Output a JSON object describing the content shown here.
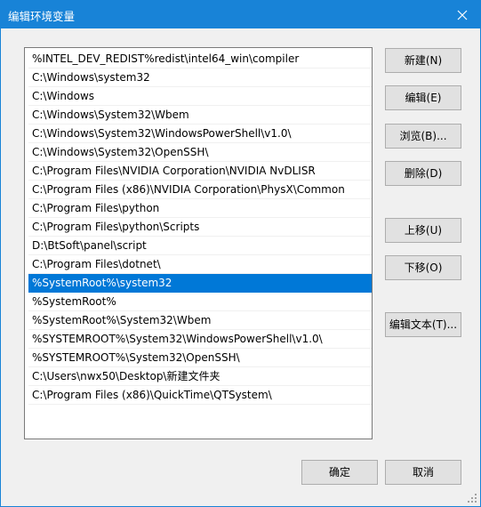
{
  "window": {
    "title": "编辑环境变量"
  },
  "paths": [
    "%INTEL_DEV_REDIST%redist\\intel64_win\\compiler",
    "C:\\Windows\\system32",
    "C:\\Windows",
    "C:\\Windows\\System32\\Wbem",
    "C:\\Windows\\System32\\WindowsPowerShell\\v1.0\\",
    "C:\\Windows\\System32\\OpenSSH\\",
    "C:\\Program Files\\NVIDIA Corporation\\NVIDIA NvDLISR",
    "C:\\Program Files (x86)\\NVIDIA Corporation\\PhysX\\Common",
    "C:\\Program Files\\python",
    "C:\\Program Files\\python\\Scripts",
    "D:\\BtSoft\\panel\\script",
    "C:\\Program Files\\dotnet\\",
    "%SystemRoot%\\system32",
    "%SystemRoot%",
    "%SystemRoot%\\System32\\Wbem",
    "%SYSTEMROOT%\\System32\\WindowsPowerShell\\v1.0\\",
    "%SYSTEMROOT%\\System32\\OpenSSH\\",
    "C:\\Users\\nwx50\\Desktop\\新建文件夹",
    "C:\\Program Files (x86)\\QuickTime\\QTSystem\\"
  ],
  "selected_index": 12,
  "buttons": {
    "new": "新建(N)",
    "edit": "编辑(E)",
    "browse": "浏览(B)...",
    "delete": "删除(D)",
    "move_up": "上移(U)",
    "move_down": "下移(O)",
    "edit_text": "编辑文本(T)...",
    "ok": "确定",
    "cancel": "取消"
  },
  "colors": {
    "titlebar": "#1883d7",
    "selection": "#0078d7"
  },
  "icons": {
    "close": "close-icon",
    "resize_grip": "resize-grip-icon"
  }
}
